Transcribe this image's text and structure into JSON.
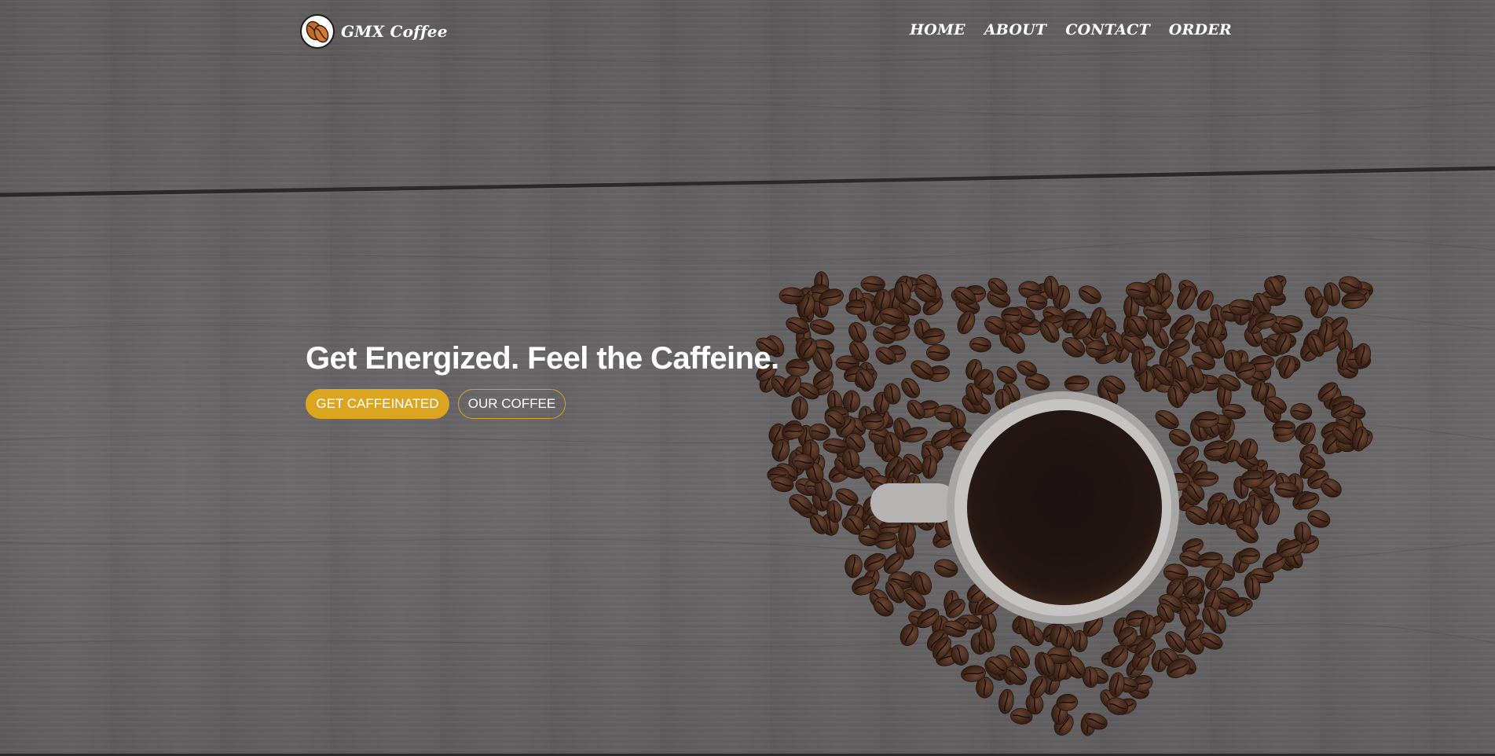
{
  "brand": {
    "name": "GMX Coffee",
    "logo_icon": "coffee-bean-icon"
  },
  "nav": {
    "items": [
      {
        "label": "HOME"
      },
      {
        "label": "ABOUT"
      },
      {
        "label": "CONTACT"
      },
      {
        "label": "ORDER"
      }
    ]
  },
  "hero": {
    "headline": "Get Energized. Feel the Caffeine.",
    "primary_button": "GET CAFFEINATED",
    "secondary_button": "OUR COFFEE",
    "image": "heart-of-coffee-beans-with-cup"
  },
  "colors": {
    "accent": "#dba51f",
    "background": "#5f5d5e",
    "text": "#ffffff"
  }
}
